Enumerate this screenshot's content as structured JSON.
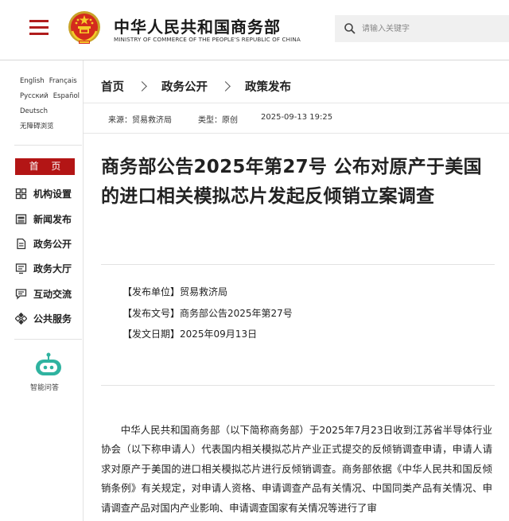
{
  "header": {
    "title": "中华人民共和国商务部",
    "subtitle": "MINISTRY OF COMMERCE OF THE PEOPLE'S REPUBLIC OF CHINA",
    "search_placeholder": "请输入关键字"
  },
  "sidebar": {
    "languages": [
      "English",
      "Français",
      "Русский",
      "Español",
      "Deutsch",
      "无障碍浏览"
    ],
    "home_label": "首 页",
    "nav_items": [
      {
        "label": "机构设置",
        "icon": "grid-icon"
      },
      {
        "label": "新闻发布",
        "icon": "news-icon"
      },
      {
        "label": "政务公开",
        "icon": "document-icon"
      },
      {
        "label": "政务大厅",
        "icon": "hall-icon"
      },
      {
        "label": "互动交流",
        "icon": "chat-icon"
      },
      {
        "label": "公共服务",
        "icon": "service-icon"
      }
    ],
    "assistant_label": "智能问答"
  },
  "breadcrumb": [
    "首页",
    "政务公开",
    "政策发布"
  ],
  "meta": {
    "source": "来源：贸易救济局",
    "type": "类型：原创",
    "datetime": "2025-09-13 19:25"
  },
  "article": {
    "title": "商务部公告2025年第27号 公布对原产于美国的进口相关模拟芯片发起反倾销立案调查",
    "info": [
      "【发布单位】贸易救济局",
      "【发布文号】商务部公告2025年第27号",
      "【发文日期】2025年09月13日"
    ],
    "body": "中华人民共和国商务部（以下简称商务部）于2025年7月23日收到江苏省半导体行业协会（以下称申请人）代表国内相关模拟芯片产业正式提交的反倾销调查申请，申请人请求对原产于美国的进口相关模拟芯片进行反倾销调查。商务部依据《中华人民共和国反倾销条例》有关规定，对申请人资格、申请调查产品有关情况、中国同类产品有关情况、申请调查产品对国内产业影响、申请调查国家有关情况等进行了审"
  },
  "colors": {
    "accent": "#b31515"
  }
}
